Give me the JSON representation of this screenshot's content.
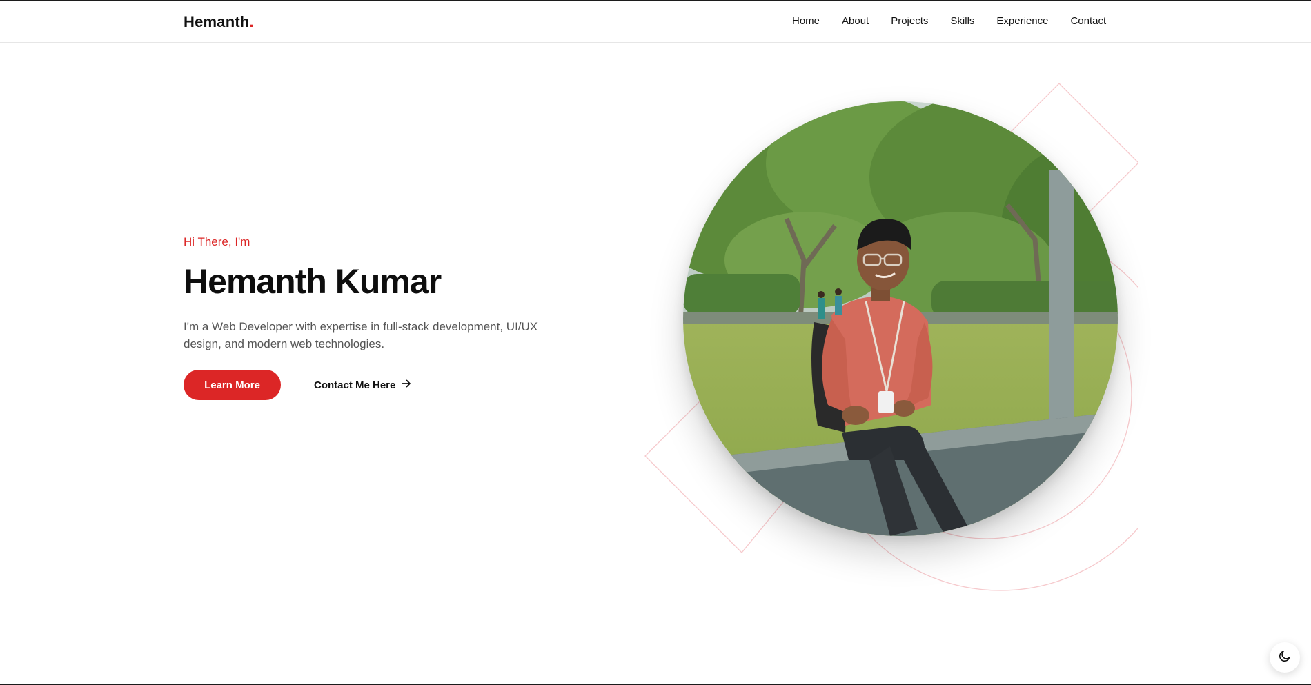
{
  "brand": {
    "name": "Hemanth",
    "dot": ".",
    "accent": "#dc2626"
  },
  "nav": {
    "links": [
      "Home",
      "About",
      "Projects",
      "Skills",
      "Experience",
      "Contact"
    ]
  },
  "hero": {
    "greeting": "Hi There, I'm",
    "name": "Hemanth Kumar",
    "description": "I'm a Web Developer with expertise in full-stack development, UI/UX design, and modern web technologies.",
    "primary_button": "Learn More",
    "secondary_button": "Contact Me Here"
  },
  "icons": {
    "secondary_button": "arrow-right-icon",
    "theme_toggle": "moon-icon"
  },
  "colors": {
    "accent": "#dc2626",
    "text": "#111111",
    "muted": "#555555"
  }
}
